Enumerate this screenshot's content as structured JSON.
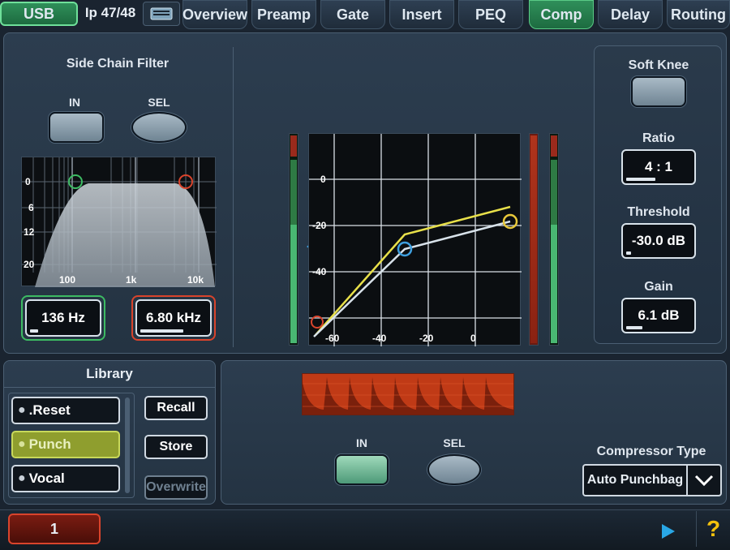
{
  "tabs": {
    "usb": "USB",
    "channel": "Ip 47/48",
    "overview": "Overview",
    "preamp": "Preamp",
    "gate": "Gate",
    "insert": "Insert",
    "peq": "PEQ",
    "comp": "Comp",
    "delay": "Delay",
    "routing": "Routing"
  },
  "sidechain": {
    "title": "Side Chain Filter",
    "in_label": "IN",
    "sel_label": "SEL",
    "y_ticks": [
      "0",
      "6",
      "12",
      "20"
    ],
    "x_ticks": [
      "100",
      "1k",
      "10k"
    ],
    "hpf_value": "136 Hz",
    "lpf_value": "6.80 kHz",
    "hpf_fraction": 0.12,
    "lpf_fraction": 0.62
  },
  "comp_graph": {
    "y_ticks": [
      "0",
      "-20",
      "-40"
    ],
    "x_ticks": [
      "-60",
      "-40",
      "-20",
      "0"
    ]
  },
  "right": {
    "soft_knee": "Soft Knee",
    "ratio_label": "Ratio",
    "ratio_value": "4 : 1",
    "ratio_fraction": 0.45,
    "threshold_label": "Threshold",
    "threshold_value": "-30.0 dB",
    "threshold_fraction": 0.07,
    "gain_label": "Gain",
    "gain_value": "6.1 dB",
    "gain_fraction": 0.25
  },
  "library": {
    "title": "Library",
    "items": [
      ".Reset",
      "Punch",
      "Vocal"
    ],
    "recall": "Recall",
    "store": "Store",
    "overwrite": "Overwrite"
  },
  "bottom": {
    "in_label": "IN",
    "sel_label": "SEL",
    "type_label": "Compressor Type",
    "type_value": "Auto Punchbag"
  },
  "status": {
    "channel_number": "1",
    "help": "?"
  },
  "colors": {
    "active_tab": "#2f8f5a",
    "hpf_ring": "#3dbb63",
    "lpf_ring": "#d9442c",
    "yellow_curve": "#e8e04a",
    "gr_meter": "#c3421c"
  }
}
